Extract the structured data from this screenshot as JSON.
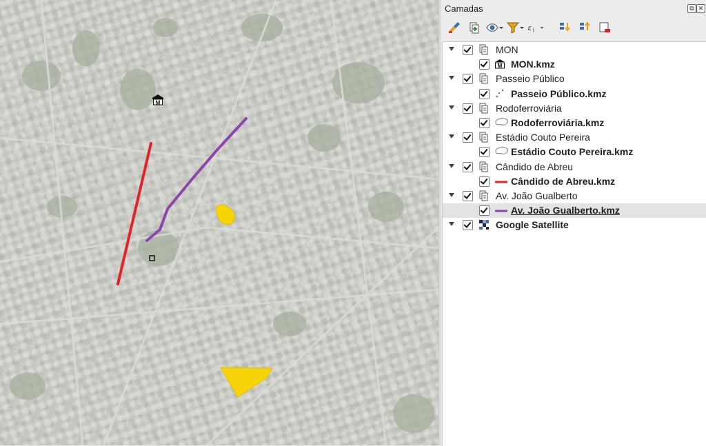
{
  "panel": {
    "title": "Camadas",
    "toolbar": [
      {
        "icon": "style-brush-icon"
      },
      {
        "icon": "add-group-icon"
      },
      {
        "icon": "visibility-eye-icon"
      },
      {
        "icon": "filter-icon"
      },
      {
        "icon": "expression-filter-icon"
      },
      {
        "icon": "expand-all-icon"
      },
      {
        "icon": "collapse-all-icon"
      },
      {
        "icon": "remove-layer-icon"
      }
    ]
  },
  "layers": [
    {
      "type": "group",
      "label": "MON",
      "checked": true,
      "expanded": true
    },
    {
      "type": "layer",
      "label": "MON.kmz",
      "symbol": "museum-icon",
      "checked": true
    },
    {
      "type": "group",
      "label": "Passeio Público",
      "checked": true,
      "expanded": true
    },
    {
      "type": "layer",
      "label": "Passeio Público.kmz",
      "symbol": "points-icon",
      "checked": true
    },
    {
      "type": "group",
      "label": "Rodoferroviária",
      "checked": true,
      "expanded": true
    },
    {
      "type": "layer",
      "label": "Rodoferroviária.kmz",
      "symbol": "polygon-icon",
      "checked": true
    },
    {
      "type": "group",
      "label": "Estádio Couto Pereira",
      "checked": true,
      "expanded": true
    },
    {
      "type": "layer",
      "label": "Estádio Couto Pereira.kmz",
      "symbol": "polygon-icon",
      "checked": true
    },
    {
      "type": "group",
      "label": "Cândido de Abreu",
      "checked": true,
      "expanded": true
    },
    {
      "type": "layer",
      "label": "Cândido de Abreu.kmz",
      "symbol": "line-icon",
      "color": "#e0242b",
      "checked": true
    },
    {
      "type": "group",
      "label": "Av. João Gualberto",
      "checked": true,
      "expanded": true
    },
    {
      "type": "layer",
      "label": "Av. João Gualberto.kmz",
      "symbol": "line-icon",
      "color": "#8e44ad",
      "checked": true,
      "selected": true
    },
    {
      "type": "raster",
      "label": "Google Satellite",
      "symbol": "raster-icon",
      "checked": true,
      "expanded": true
    }
  ],
  "map": {
    "red_line_color": "#e0242b",
    "purple_line_color": "#8e44ad",
    "polygon_fill": "#f7d40a"
  }
}
